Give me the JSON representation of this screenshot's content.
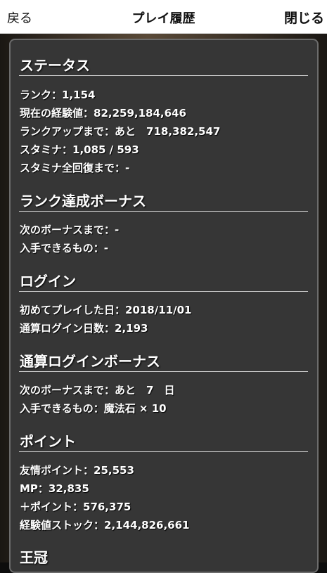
{
  "nav": {
    "back_label": "戻る",
    "title": "プレイ履歴",
    "close_label": "閉じる"
  },
  "sections": {
    "status": {
      "heading": "ステータス",
      "rank": "ランク：1,154",
      "current_exp": "現在の経験値：82,259,184,646",
      "rank_up": "ランクアップまで：あと　718,382,547",
      "stamina": "スタミナ：1,085 / 593",
      "stamina_full": "スタミナ全回復まで：-"
    },
    "rank_bonus": {
      "heading": "ランク達成ボーナス",
      "next_bonus": "次のボーナスまで：-",
      "obtainable": "入手できるもの：-"
    },
    "login": {
      "heading": "ログイン",
      "first_play": "初めてプレイした日：2018/11/01",
      "total_days": "通算ログイン日数：2,193"
    },
    "login_bonus": {
      "heading": "通算ログインボーナス",
      "next_bonus": "次のボーナスまで：あと　7　日",
      "obtainable": "入手できるもの：魔法石 × 10"
    },
    "points": {
      "heading": "ポイント",
      "friend_points": "友情ポイント：25,553",
      "mp": "MP：32,835",
      "plus_points": "＋ポイント：576,375",
      "exp_stock": "経験値ストック：2,144,826,661"
    },
    "crown": {
      "heading": "王冠"
    }
  }
}
